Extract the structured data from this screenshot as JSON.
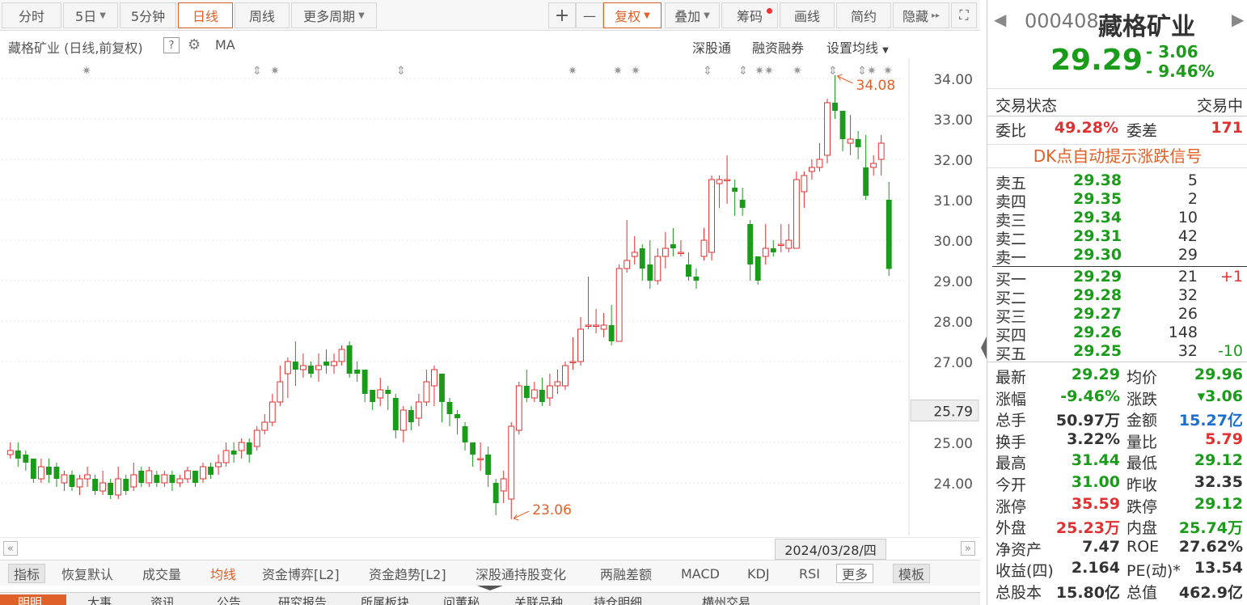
{
  "toolbar": {
    "fenshi": "分时",
    "five_day": "5日",
    "five_min": "5分钟",
    "daily": "日线",
    "weekly": "周线",
    "more_periods": "更多周期",
    "plus": "+",
    "minus": "—",
    "fuquan": "复权",
    "overlay": "叠加",
    "chips": "筹码",
    "draw": "画线",
    "simple": "简约",
    "hide": "隐藏"
  },
  "chart_header": {
    "title": "藏格矿业 (日线,前复权)",
    "help": "?",
    "ma": "MA",
    "shengutong": "深股通",
    "margin": "融资融券",
    "set_ma": "设置均线"
  },
  "chart_data": {
    "type": "candlestick",
    "y_ticks": [
      "34.00",
      "33.00",
      "32.00",
      "31.00",
      "30.00",
      "29.00",
      "28.00",
      "27.00",
      "25.00",
      "24.00"
    ],
    "ylim": [
      22.9,
      34.3
    ],
    "crosshair_value": "25.79",
    "annotations": [
      {
        "label": "34.08",
        "type": "high"
      },
      {
        "label": "23.06",
        "type": "low"
      }
    ],
    "up_color": "#e03030",
    "down_color": "#1a9b1a",
    "candles": [
      [
        24.7,
        24.8,
        25.0,
        24.6
      ],
      [
        24.8,
        24.6,
        25.0,
        24.4
      ],
      [
        24.7,
        24.5,
        24.8,
        24.3
      ],
      [
        24.6,
        24.1,
        24.6,
        24.0
      ],
      [
        24.1,
        24.4,
        24.6,
        24.0
      ],
      [
        24.4,
        24.2,
        24.6,
        24.0
      ],
      [
        24.4,
        24.1,
        24.5,
        23.9
      ],
      [
        24.0,
        24.2,
        24.3,
        23.8
      ],
      [
        24.2,
        23.9,
        24.3,
        23.8
      ],
      [
        23.9,
        24.1,
        24.2,
        23.7
      ],
      [
        24.1,
        24.2,
        24.4,
        23.9
      ],
      [
        24.1,
        23.8,
        24.2,
        23.7
      ],
      [
        23.8,
        24.0,
        24.3,
        23.7
      ],
      [
        24.0,
        23.7,
        24.1,
        23.6
      ],
      [
        23.7,
        24.1,
        24.4,
        23.6
      ],
      [
        24.1,
        23.8,
        24.2,
        23.7
      ],
      [
        23.9,
        24.2,
        24.5,
        23.8
      ],
      [
        24.3,
        24.0,
        24.4,
        23.9
      ],
      [
        24.0,
        24.3,
        24.4,
        23.9
      ],
      [
        24.2,
        24.0,
        24.3,
        23.9
      ],
      [
        24.0,
        24.2,
        24.3,
        23.9
      ],
      [
        24.2,
        24.0,
        24.3,
        23.8
      ],
      [
        24.0,
        24.1,
        24.2,
        23.9
      ],
      [
        24.1,
        24.3,
        24.4,
        24.0
      ],
      [
        24.3,
        24.0,
        24.3,
        23.9
      ],
      [
        24.1,
        24.4,
        24.5,
        24.0
      ],
      [
        24.4,
        24.2,
        24.5,
        24.1
      ],
      [
        24.4,
        24.5,
        24.7,
        24.2
      ],
      [
        24.5,
        24.8,
        25.0,
        24.4
      ],
      [
        24.8,
        24.7,
        25.0,
        24.5
      ],
      [
        24.8,
        25.0,
        25.1,
        24.6
      ],
      [
        25.0,
        24.7,
        25.1,
        24.5
      ],
      [
        24.9,
        25.3,
        25.4,
        24.8
      ],
      [
        25.3,
        25.5,
        25.7,
        25.2
      ],
      [
        25.5,
        26.0,
        26.2,
        25.4
      ],
      [
        26.0,
        26.5,
        26.9,
        25.9
      ],
      [
        26.7,
        27.0,
        27.1,
        26.1
      ],
      [
        27.0,
        26.8,
        27.5,
        26.4
      ],
      [
        26.8,
        26.9,
        27.2,
        26.6
      ],
      [
        26.9,
        26.7,
        27.0,
        26.6
      ],
      [
        26.8,
        26.9,
        27.2,
        26.5
      ],
      [
        27.0,
        26.9,
        27.3,
        26.7
      ],
      [
        26.9,
        27.0,
        27.2,
        26.7
      ],
      [
        27.0,
        27.3,
        27.4,
        26.9
      ],
      [
        27.4,
        26.7,
        27.5,
        26.6
      ],
      [
        26.8,
        26.7,
        27.0,
        26.5
      ],
      [
        26.8,
        26.2,
        26.8,
        26.0
      ],
      [
        26.3,
        26.0,
        26.3,
        25.8
      ],
      [
        26.1,
        26.3,
        26.6,
        25.9
      ],
      [
        26.3,
        26.2,
        26.4,
        25.8
      ],
      [
        26.1,
        25.3,
        26.2,
        25.1
      ],
      [
        25.3,
        25.8,
        25.9,
        25.0
      ],
      [
        25.8,
        25.5,
        25.9,
        25.3
      ],
      [
        25.6,
        26.0,
        26.2,
        25.4
      ],
      [
        26.0,
        26.5,
        26.8,
        25.9
      ],
      [
        26.4,
        26.8,
        26.9,
        25.9
      ],
      [
        26.7,
        26.0,
        26.7,
        25.5
      ],
      [
        26.0,
        25.7,
        26.1,
        25.4
      ],
      [
        25.7,
        25.6,
        25.8,
        25.2
      ],
      [
        25.4,
        25.0,
        25.5,
        24.8
      ],
      [
        25.0,
        24.7,
        25.0,
        24.4
      ],
      [
        24.6,
        24.6,
        25.0,
        24.3
      ],
      [
        24.7,
        24.2,
        24.9,
        23.9
      ],
      [
        24.0,
        23.5,
        24.1,
        23.2
      ],
      [
        23.8,
        24.1,
        24.3,
        23.5
      ],
      [
        23.6,
        25.4,
        25.5,
        23.1
      ],
      [
        25.3,
        26.4,
        26.5,
        25.2
      ],
      [
        26.4,
        26.1,
        26.8,
        26.0
      ],
      [
        26.1,
        26.3,
        26.5,
        26.0
      ],
      [
        26.3,
        26.0,
        26.6,
        25.9
      ],
      [
        26.1,
        26.4,
        26.7,
        25.9
      ],
      [
        26.4,
        26.5,
        26.8,
        26.2
      ],
      [
        26.4,
        26.9,
        27.0,
        26.3
      ],
      [
        27.0,
        27.0,
        27.6,
        26.8
      ],
      [
        27.0,
        27.8,
        28.1,
        26.9
      ],
      [
        27.9,
        27.9,
        29.1,
        27.8
      ],
      [
        27.9,
        27.9,
        28.3,
        27.7
      ],
      [
        27.8,
        27.9,
        28.2,
        27.6
      ],
      [
        27.9,
        27.5,
        28.4,
        27.4
      ],
      [
        27.5,
        29.3,
        29.4,
        27.5
      ],
      [
        29.3,
        29.5,
        30.5,
        29.2
      ],
      [
        29.6,
        29.7,
        30.1,
        29.4
      ],
      [
        29.8,
        29.3,
        29.9,
        29.0
      ],
      [
        29.4,
        29.0,
        30.0,
        28.8
      ],
      [
        29.0,
        29.6,
        29.8,
        28.9
      ],
      [
        29.6,
        29.8,
        30.2,
        29.3
      ],
      [
        29.9,
        29.8,
        30.3,
        29.6
      ],
      [
        29.7,
        29.7,
        30.0,
        29.6
      ],
      [
        29.4,
        29.1,
        29.7,
        29.0
      ],
      [
        29.1,
        29.0,
        29.3,
        28.8
      ],
      [
        29.6,
        30.0,
        30.3,
        29.5
      ],
      [
        29.7,
        31.5,
        31.6,
        29.5
      ],
      [
        31.4,
        31.5,
        31.6,
        30.8
      ],
      [
        31.5,
        31.5,
        32.1,
        30.9
      ],
      [
        31.3,
        31.2,
        31.5,
        30.6
      ],
      [
        31.0,
        30.8,
        31.3,
        30.6
      ],
      [
        30.4,
        29.4,
        30.5,
        29.0
      ],
      [
        29.6,
        29.0,
        29.6,
        28.9
      ],
      [
        29.6,
        29.8,
        30.4,
        29.4
      ],
      [
        29.8,
        29.7,
        30.0,
        29.6
      ],
      [
        29.9,
        29.9,
        30.4,
        29.7
      ],
      [
        29.8,
        30.0,
        30.4,
        29.7
      ],
      [
        29.8,
        31.5,
        31.7,
        29.8
      ],
      [
        31.2,
        31.6,
        31.7,
        30.8
      ],
      [
        31.7,
        31.8,
        32.0,
        31.5
      ],
      [
        31.8,
        32.0,
        32.4,
        31.7
      ],
      [
        32.1,
        33.4,
        33.5,
        31.9
      ],
      [
        33.4,
        33.2,
        34.08,
        33.0
      ],
      [
        33.2,
        32.5,
        33.2,
        32.2
      ],
      [
        32.4,
        32.5,
        33.1,
        32.1
      ],
      [
        32.5,
        32.3,
        32.7,
        32.0
      ],
      [
        31.8,
        31.1,
        32.6,
        31.0
      ],
      [
        31.8,
        31.9,
        32.1,
        31.6
      ],
      [
        32.0,
        32.4,
        32.6,
        31.6
      ],
      [
        31.0,
        29.29,
        31.44,
        29.12
      ]
    ]
  },
  "event_marks": [
    "✷",
    "⇕",
    "✷",
    "⇕",
    "✷",
    "✷",
    "✷",
    "⇕",
    "⇕",
    "✷✷",
    "✷",
    "⇕",
    "⇕✷",
    "✷"
  ],
  "date_label": "2024/03/28/四",
  "indicators": {
    "zhibiao": "指标",
    "restore": "恢复默认",
    "volume": "成交量",
    "ma_line": "均线",
    "capital_game": "资金博弈[L2]",
    "capital_trend": "资金趋势[L2]",
    "hk_change": "深股通持股变化",
    "margin_diff": "两融差额",
    "macd": "MACD",
    "kdj": "KDJ",
    "rsi": "RSI",
    "more": "更多",
    "template": "模板"
  },
  "bottom_tabs": [
    "明明",
    "大事",
    "资讯",
    "公告",
    "研究报告",
    "所属板块",
    "问董秘",
    "关联品种",
    "持仓明细",
    "横州交易"
  ],
  "stock": {
    "code": "000408",
    "name": "藏格矿业",
    "price": "29.29",
    "change": "- 3.06",
    "change_pct": "- 9.46%"
  },
  "status": {
    "label": "交易状态",
    "value": "交易中"
  },
  "commission": {
    "ratio_label": "委比",
    "ratio": "49.28%",
    "diff_label": "委差",
    "diff": "171"
  },
  "dk_signal": "DK点自动提示涨跌信号",
  "asks": [
    {
      "label": "卖五",
      "price": "29.38",
      "vol": "5",
      "chg": ""
    },
    {
      "label": "卖四",
      "price": "29.35",
      "vol": "2",
      "chg": ""
    },
    {
      "label": "卖三",
      "price": "29.34",
      "vol": "10",
      "chg": ""
    },
    {
      "label": "卖二",
      "price": "29.31",
      "vol": "42",
      "chg": ""
    },
    {
      "label": "卖一",
      "price": "29.30",
      "vol": "29",
      "chg": ""
    }
  ],
  "bids": [
    {
      "label": "买一",
      "price": "29.29",
      "vol": "21",
      "chg": "+1"
    },
    {
      "label": "买二",
      "price": "29.28",
      "vol": "32",
      "chg": ""
    },
    {
      "label": "买三",
      "price": "29.27",
      "vol": "26",
      "chg": ""
    },
    {
      "label": "买四",
      "price": "29.26",
      "vol": "148",
      "chg": ""
    },
    {
      "label": "买五",
      "price": "29.25",
      "vol": "32",
      "chg": "-10"
    }
  ],
  "quotes": [
    {
      "l1": "最新",
      "v1": "29.29",
      "c1": "green",
      "l2": "均价",
      "v2": "29.96",
      "c2": "green"
    },
    {
      "l1": "涨幅",
      "v1": "-9.46%",
      "c1": "green",
      "l2": "涨跌",
      "v2": "▾3.06",
      "c2": "green"
    },
    {
      "l1": "总手",
      "v1": "50.97万",
      "c1": "dark",
      "l2": "金额",
      "v2": "15.27亿",
      "c2": "blue"
    },
    {
      "l1": "换手",
      "v1": "3.22%",
      "c1": "dark",
      "l2": "量比",
      "v2": "5.79",
      "c2": "red"
    },
    {
      "l1": "最高",
      "v1": "31.44",
      "c1": "green",
      "l2": "最低",
      "v2": "29.12",
      "c2": "green"
    },
    {
      "l1": "今开",
      "v1": "31.00",
      "c1": "green",
      "l2": "昨收",
      "v2": "32.35",
      "c2": "dark"
    },
    {
      "l1": "涨停",
      "v1": "35.59",
      "c1": "red",
      "l2": "跌停",
      "v2": "29.12",
      "c2": "green"
    },
    {
      "l1": "外盘",
      "v1": "25.23万",
      "c1": "red",
      "l2": "内盘",
      "v2": "25.74万",
      "c2": "green"
    },
    {
      "l1": "净资产",
      "v1": "7.47",
      "c1": "dark",
      "l2": "ROE",
      "v2": "27.62%",
      "c2": "dark"
    },
    {
      "l1": "收益(四)",
      "v1": "2.164",
      "c1": "dark",
      "l2": "PE(动)*",
      "v2": "13.54",
      "c2": "dark"
    },
    {
      "l1": "总股本",
      "v1": "15.80亿",
      "c1": "dark",
      "l2": "总值",
      "v2": "462.9亿",
      "c2": "dark"
    }
  ]
}
